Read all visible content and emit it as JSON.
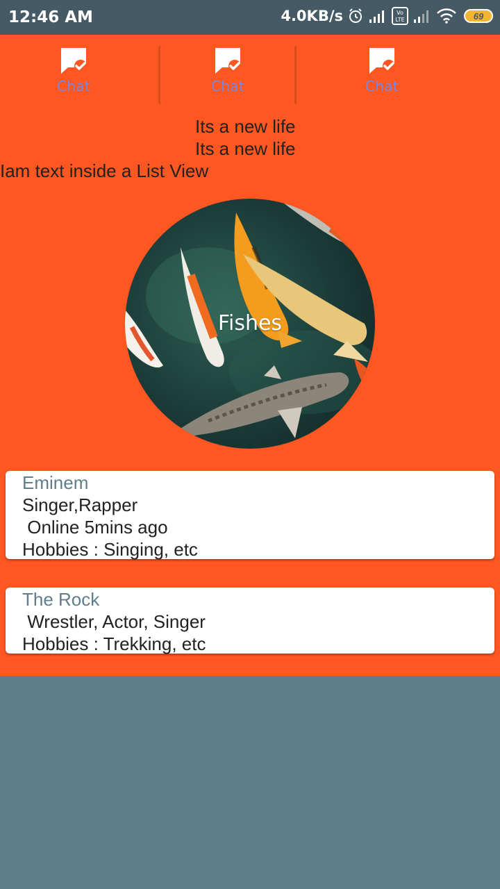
{
  "status_bar": {
    "time": "12:46 AM",
    "speed": "4.0KB/s",
    "battery": "69",
    "icons": [
      "alarm-icon",
      "signal-icon",
      "volte-icon",
      "signal-icon",
      "wifi-icon",
      "battery-icon"
    ]
  },
  "tabs": [
    {
      "label": "Chat",
      "icon": "chat-check-icon"
    },
    {
      "label": "Chat",
      "icon": "chat-check-icon"
    },
    {
      "label": "Chat",
      "icon": "chat-check-icon"
    }
  ],
  "texts": {
    "line1": "Its a new life",
    "line2": "Its a new life",
    "line3": "Iam text inside a List View"
  },
  "image": {
    "label": "Fishes"
  },
  "cards": [
    {
      "title": "Eminem",
      "lines": [
        "Singer,Rapper",
        " Online 5mins ago",
        "Hobbies : Singing, etc"
      ]
    },
    {
      "title": "The Rock",
      "lines": [
        " Wrestler, Actor, Singer",
        "Hobbies : Trekking, etc"
      ]
    }
  ],
  "colors": {
    "primary": "#FF5722",
    "background": "#607D8B",
    "status_bar": "#455A64",
    "tab_label": "#7D86DC"
  }
}
